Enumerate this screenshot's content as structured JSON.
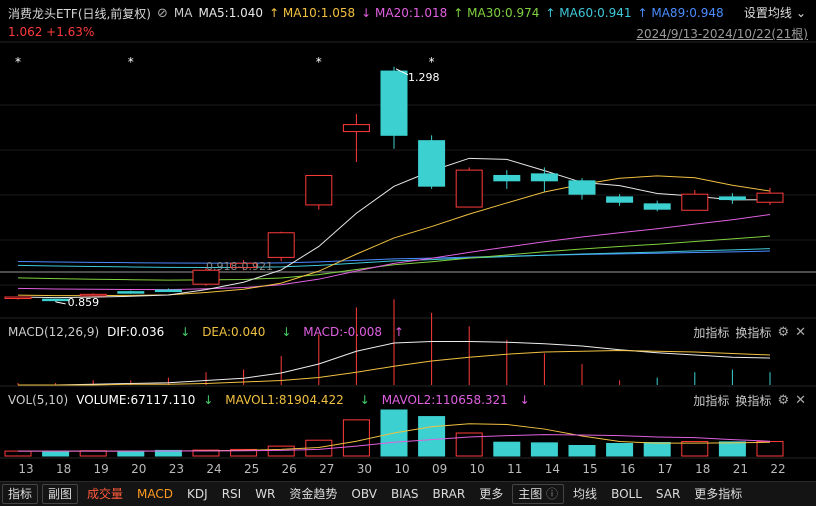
{
  "header": {
    "title": "消费龙头ETF(日线,前复权)",
    "ma_label": "MA",
    "ma": [
      {
        "label": "MA5:1.040",
        "color": "#e8e8e8",
        "arrow": ""
      },
      {
        "label": "MA10:1.058",
        "color": "#f0c040",
        "arrow": "↑"
      },
      {
        "label": "MA20:1.018",
        "color": "#e060e0",
        "arrow": "↓"
      },
      {
        "label": "MA30:0.974",
        "color": "#80d040",
        "arrow": "↑"
      },
      {
        "label": "MA60:0.941",
        "color": "#40c8d8",
        "arrow": "↑"
      },
      {
        "label": "MA89:0.948",
        "color": "#4a8cff",
        "arrow": "↑"
      }
    ],
    "settings_label": "设置均线",
    "price": "1.062  +1.63%",
    "date_range": "2024/9/13-2024/10/22(21根)"
  },
  "main_annotations": {
    "high": "1.298",
    "low": "0.859",
    "mid": "0.918-0.921"
  },
  "macd": {
    "name": "MACD(12,26,9)",
    "dif": "DIF:0.036",
    "dea": "DEA:0.040",
    "macd": "MACD:-0.008",
    "add": "加指标",
    "switch": "换指标"
  },
  "vol": {
    "name": "VOL(5,10)",
    "volume": "VOLUME:67117.110",
    "mavol1": "MAVOL1:81904.422",
    "mavol2": "MAVOL2:110658.321",
    "add": "加指标",
    "switch": "换指标"
  },
  "x_labels": [
    "13",
    "18",
    "19",
    "20",
    "23",
    "24",
    "25",
    "26",
    "27",
    "30",
    "10",
    "09",
    "10",
    "11",
    "14",
    "15",
    "16",
    "17",
    "18",
    "21",
    "22"
  ],
  "bottom_tabs": [
    {
      "label": "指标",
      "style": "box"
    },
    {
      "label": "副图",
      "style": "box"
    },
    {
      "label": "成交量",
      "style": "active-red"
    },
    {
      "label": "MACD",
      "style": "active-orange"
    },
    {
      "label": "KDJ",
      "style": ""
    },
    {
      "label": "RSI",
      "style": ""
    },
    {
      "label": "WR",
      "style": ""
    },
    {
      "label": "资金趋势",
      "style": ""
    },
    {
      "label": "OBV",
      "style": ""
    },
    {
      "label": "BIAS",
      "style": ""
    },
    {
      "label": "BRAR",
      "style": ""
    },
    {
      "label": "更多",
      "style": ""
    },
    {
      "label": "主图",
      "style": "box"
    },
    {
      "label": "均线",
      "style": ""
    },
    {
      "label": "BOLL",
      "style": ""
    },
    {
      "label": "SAR",
      "style": ""
    },
    {
      "label": "更多指标",
      "style": ""
    }
  ],
  "chart_data": {
    "type": "candlestick",
    "categories": [
      "13",
      "18",
      "19",
      "20",
      "23",
      "24",
      "25",
      "26",
      "27",
      "30",
      "10",
      "09",
      "10",
      "11",
      "14",
      "15",
      "16",
      "17",
      "18",
      "21",
      "22"
    ],
    "ohlc": [
      [
        0.866,
        0.869,
        0.863,
        0.868
      ],
      [
        0.864,
        0.863,
        0.859,
        0.862
      ],
      [
        0.872,
        0.875,
        0.869,
        0.873
      ],
      [
        0.878,
        0.88,
        0.874,
        0.876
      ],
      [
        0.881,
        0.884,
        0.878,
        0.88
      ],
      [
        0.892,
        0.922,
        0.889,
        0.918
      ],
      [
        0.923,
        0.937,
        0.918,
        0.931
      ],
      [
        0.942,
        0.99,
        0.935,
        0.988
      ],
      [
        1.04,
        1.062,
        1.031,
        1.095
      ],
      [
        1.177,
        1.21,
        1.12,
        1.19
      ],
      [
        1.29,
        1.298,
        1.145,
        1.17
      ],
      [
        1.16,
        1.17,
        1.07,
        1.075
      ],
      [
        1.036,
        1.11,
        1.036,
        1.105
      ],
      [
        1.095,
        1.105,
        1.07,
        1.085
      ],
      [
        1.098,
        1.11,
        1.065,
        1.085
      ],
      [
        1.085,
        1.09,
        1.05,
        1.06
      ],
      [
        1.055,
        1.06,
        1.038,
        1.045
      ],
      [
        1.042,
        1.048,
        1.028,
        1.032
      ],
      [
        1.03,
        1.068,
        1.03,
        1.06
      ],
      [
        1.055,
        1.062,
        1.042,
        1.05
      ],
      [
        1.045,
        1.072,
        1.04,
        1.062
      ]
    ],
    "ylim": [
      0.84,
      1.32
    ],
    "macd_dif": [
      0.0,
      0.0,
      0.001,
      0.002,
      0.003,
      0.006,
      0.009,
      0.016,
      0.028,
      0.045,
      0.056,
      0.058,
      0.058,
      0.057,
      0.055,
      0.052,
      0.047,
      0.043,
      0.04,
      0.037,
      0.036
    ],
    "macd_dea": [
      0.0,
      0.0,
      0.0,
      0.001,
      0.001,
      0.002,
      0.004,
      0.006,
      0.01,
      0.017,
      0.025,
      0.032,
      0.037,
      0.041,
      0.044,
      0.045,
      0.046,
      0.045,
      0.044,
      0.042,
      0.04
    ],
    "volume": [
      15000,
      14000,
      16000,
      15000,
      17000,
      18000,
      20000,
      30000,
      48000,
      110000,
      140000,
      120000,
      70000,
      42000,
      40000,
      32000,
      38000,
      41000,
      44000,
      43000,
      44000
    ],
    "mavol1": [
      15000,
      15000,
      15000,
      15000,
      15400,
      16000,
      17200,
      20000,
      26000,
      45000,
      70000,
      89000,
      98000,
      96000,
      82000,
      61000,
      44000,
      39000,
      39000,
      40000,
      42000
    ],
    "mavol2": [
      15000,
      15000,
      15000,
      15000,
      15200,
      15400,
      16000,
      17200,
      20000,
      30000,
      42000,
      50000,
      58000,
      62000,
      65000,
      64000,
      62000,
      58000,
      56000,
      50000,
      45000
    ],
    "series_colors": {
      "ma5": "#e8e8e8",
      "ma10": "#f0c040",
      "ma20": "#e060e0",
      "ma30": "#80d040",
      "ma60": "#40c8d8",
      "ma89": "#4a8cff",
      "up": "#ff3b3b",
      "down": "#3cd0d0"
    }
  }
}
